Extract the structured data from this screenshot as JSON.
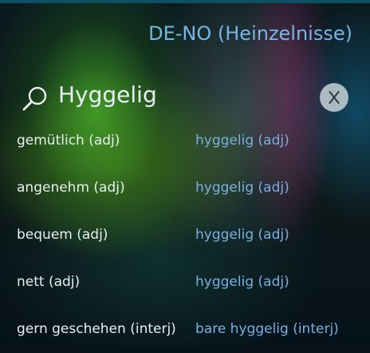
{
  "header": {
    "title": "DE-NO (Heinzelnisse)"
  },
  "search": {
    "value": "Hyggelig",
    "icon": "search-icon",
    "clear_icon": "close-icon"
  },
  "results": [
    {
      "source": "gemütlich (adj)",
      "target": "hyggelig (adj)"
    },
    {
      "source": "angenehm (adj)",
      "target": "hyggelig (adj)"
    },
    {
      "source": "bequem (adj)",
      "target": "hyggelig (adj)"
    },
    {
      "source": "nett (adj)",
      "target": "hyggelig (adj)"
    },
    {
      "source": "gern geschehen (interj)",
      "target": "bare hyggelig (interj)"
    }
  ],
  "colors": {
    "title": "#76b6e4",
    "source_text": "#e9eef0",
    "target_text": "#79b0e0",
    "clear_button": "#cdd7dc"
  }
}
